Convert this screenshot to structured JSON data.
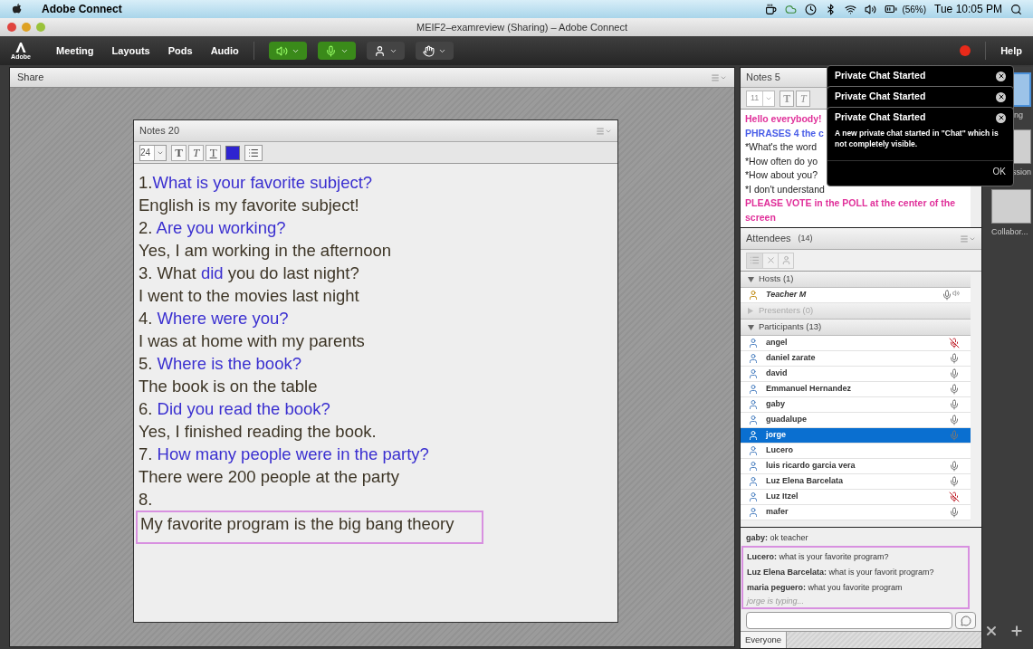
{
  "menubar": {
    "app": "Adobe Connect",
    "battery": "(56%)",
    "clock": "Tue 10:05 PM"
  },
  "window": {
    "title": "MEIF2–examreview (Sharing) – Adobe Connect"
  },
  "toolbar": {
    "logo_text": "Adobe",
    "menus": [
      "Meeting",
      "Layouts",
      "Pods",
      "Audio"
    ],
    "speaker_on": true,
    "mic_on": true,
    "recording": true,
    "help": "Help"
  },
  "share_pod": {
    "title": "Share"
  },
  "notes_pod": {
    "title": "Notes 20",
    "font_size": "24",
    "format_buttons": [
      "T",
      "T",
      "T"
    ],
    "lines": [
      {
        "annotated": false,
        "segments": [
          {
            "text": "1.",
            "kind": "plain"
          },
          {
            "text": "What is your favorite subject?",
            "kind": "highlight"
          }
        ]
      },
      {
        "annotated": false,
        "segments": [
          {
            "text": "English is my favorite subject!",
            "kind": "plain"
          }
        ]
      },
      {
        "annotated": false,
        "segments": [
          {
            "text": "2. ",
            "kind": "plain"
          },
          {
            "text": "Are you working?",
            "kind": "highlight"
          }
        ]
      },
      {
        "annotated": false,
        "segments": [
          {
            "text": "Yes, I am working in the afternoon",
            "kind": "plain"
          }
        ]
      },
      {
        "annotated": false,
        "segments": [
          {
            "text": "3. What ",
            "kind": "plain"
          },
          {
            "text": "did",
            "kind": "highlight"
          },
          {
            "text": " you do last night?",
            "kind": "plain"
          }
        ]
      },
      {
        "annotated": false,
        "segments": [
          {
            "text": "I went to the movies last night",
            "kind": "plain"
          }
        ]
      },
      {
        "annotated": false,
        "segments": [
          {
            "text": "4. ",
            "kind": "plain"
          },
          {
            "text": "Where were you?",
            "kind": "highlight"
          }
        ]
      },
      {
        "annotated": false,
        "segments": [
          {
            "text": "I was at home with my parents",
            "kind": "plain"
          }
        ]
      },
      {
        "annotated": false,
        "segments": [
          {
            "text": "5. ",
            "kind": "plain"
          },
          {
            "text": "Where is the book?",
            "kind": "highlight"
          }
        ]
      },
      {
        "annotated": false,
        "segments": [
          {
            "text": "The book is on the table",
            "kind": "plain"
          }
        ]
      },
      {
        "annotated": false,
        "segments": [
          {
            "text": "6. ",
            "kind": "plain"
          },
          {
            "text": "Did you read the book?",
            "kind": "highlight"
          }
        ]
      },
      {
        "annotated": false,
        "segments": [
          {
            "text": "Yes, I finished reading the book.",
            "kind": "plain"
          }
        ]
      },
      {
        "annotated": false,
        "segments": [
          {
            "text": "7. ",
            "kind": "plain"
          },
          {
            "text": "How many people were in the party?",
            "kind": "highlight"
          }
        ]
      },
      {
        "annotated": false,
        "segments": [
          {
            "text": "There were 200 people at the party",
            "kind": "plain"
          }
        ]
      },
      {
        "annotated": false,
        "segments": [
          {
            "text": "8.",
            "kind": "plain"
          }
        ]
      },
      {
        "annotated": true,
        "segments": [
          {
            "text": "My favorite program is the big bang theory",
            "kind": "plain"
          }
        ]
      }
    ]
  },
  "notes_small_pod": {
    "title": "Notes 5",
    "font_size": "11",
    "format_buttons": [
      "T",
      "T"
    ],
    "lines": [
      {
        "text": "Hello everybody!",
        "kind": "pink"
      },
      {
        "text": "PHRASES 4 the c",
        "kind": "blue"
      },
      {
        "text": "*What's the word",
        "kind": "plain"
      },
      {
        "text": "*How often do yo",
        "kind": "plain"
      },
      {
        "text": "*How about you?",
        "kind": "plain"
      },
      {
        "text": "*I don't understand",
        "kind": "plain"
      },
      {
        "text": "PLEASE VOTE in the POLL at the center of the screen",
        "kind": "pink"
      }
    ]
  },
  "attendees": {
    "title": "Attendees",
    "count": "(14)",
    "groups": [
      {
        "label": "Hosts (1)",
        "expanded": true,
        "people": [
          {
            "name": "Teacher M",
            "host": true,
            "kind": "speaking",
            "selected": false
          }
        ]
      },
      {
        "label": "Presenters (0)",
        "expanded": false
      },
      {
        "label": "Participants (13)",
        "expanded": true,
        "people": [
          {
            "name": "angel",
            "kind": "muted",
            "selected": false
          },
          {
            "name": "daniel zarate",
            "kind": "on",
            "selected": false
          },
          {
            "name": "david",
            "kind": "on",
            "selected": false
          },
          {
            "name": "Emmanuel Hernandez",
            "kind": "on",
            "selected": false
          },
          {
            "name": "gaby",
            "kind": "on",
            "selected": false
          },
          {
            "name": "guadalupe",
            "kind": "on",
            "selected": false
          },
          {
            "name": "jorge",
            "kind": "on",
            "selected": true
          },
          {
            "name": "Lucero",
            "kind": "none",
            "selected": false
          },
          {
            "name": "luis ricardo garcia vera",
            "kind": "on",
            "selected": false
          },
          {
            "name": "Luz Elena Barcelata",
            "kind": "on",
            "selected": false
          },
          {
            "name": "Luz Itzel",
            "kind": "muted",
            "selected": false
          },
          {
            "name": "mafer",
            "kind": "on",
            "selected": false
          }
        ]
      }
    ]
  },
  "chat": {
    "messages": [
      {
        "sender": "gaby:",
        "text": "ok teacher",
        "annotated": false
      },
      {
        "sender": "Lucero:",
        "text": "what is your favorite program?",
        "annotated": true
      },
      {
        "sender": "Luz Elena Barcelata:",
        "text": "what is your favorit program?",
        "annotated": true
      },
      {
        "sender": "maria peguero:",
        "text": "what you favorite program",
        "annotated": true
      }
    ],
    "typing": "jorge is typing...",
    "recipient": "Everyone"
  },
  "notifications": [
    {
      "title": "Private Chat Started"
    },
    {
      "title": "Private Chat Started"
    },
    {
      "title": "Private Chat Started",
      "message": "A new private chat started in \"Chat\"  which is not completely visible.",
      "button": "OK"
    }
  ],
  "layouts": [
    "ng",
    "ssion",
    "Collabor..."
  ]
}
